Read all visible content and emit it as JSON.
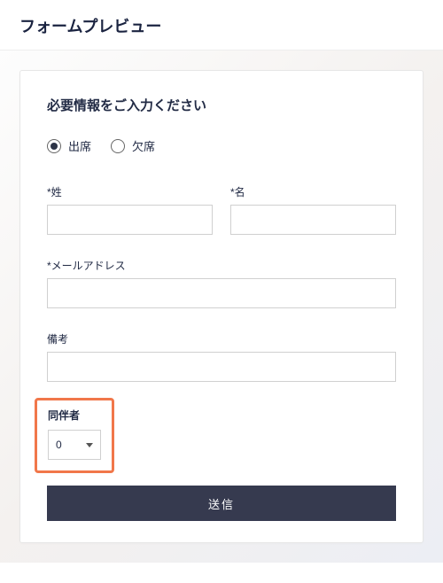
{
  "page_title": "フォームプレビュー",
  "card": {
    "title": "必要情報をご入力ください",
    "attendance": {
      "attend": {
        "label": "出席",
        "checked": true
      },
      "absent": {
        "label": "欠席",
        "checked": false
      }
    },
    "last_name_label": "*姓",
    "first_name_label": "*名",
    "email_label": "*メールアドレス",
    "notes_label": "備考",
    "companions": {
      "label": "同伴者",
      "value": "0"
    },
    "submit_label": "送信"
  }
}
